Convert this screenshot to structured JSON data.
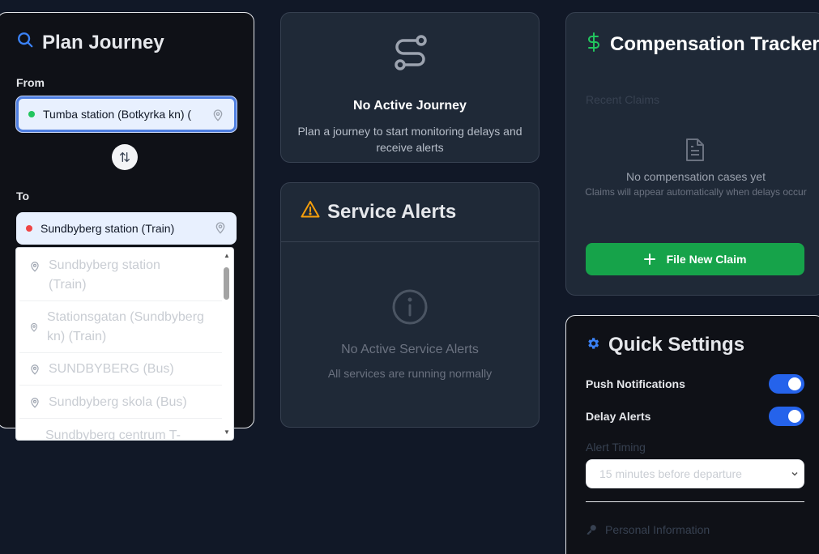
{
  "plan_journey": {
    "title": "Plan Journey",
    "from_label": "From",
    "from_value": "Tumba station (Botkyrka kn) (",
    "to_label": "To",
    "to_value": "Sundbyberg station (Train)",
    "suggestions": [
      "Sundbyberg station (Train)",
      "Stationsgatan (Sundbyberg kn) (Train)",
      "SUNDBYBERG (Bus)",
      "Sundbyberg skola (Bus)",
      "Sundbyberg centrum T-"
    ]
  },
  "no_journey": {
    "title": "No Active Journey",
    "text": "Plan a journey to start monitoring delays and receive alerts"
  },
  "service_alerts": {
    "title": "Service Alerts",
    "empty_title": "No Active Service Alerts",
    "empty_text": "All services are running normally"
  },
  "compensation": {
    "title": "Compensation Tracker",
    "recent_label": "Recent Claims",
    "empty_title": "No compensation cases yet",
    "empty_text": "Claims will appear automatically when delays occur",
    "file_button": "File New Claim"
  },
  "quick_settings": {
    "title": "Quick Settings",
    "push_label": "Push Notifications",
    "push_on": true,
    "delay_label": "Delay Alerts",
    "delay_on": true,
    "timing_label": "Alert Timing",
    "timing_value": "15 minutes before departure",
    "personal_label": "Personal Information"
  },
  "colors": {
    "accent_blue": "#2563eb",
    "green": "#16a34a",
    "from_dot": "#22c55e",
    "to_dot": "#ef4444",
    "warning": "#f59e0b"
  }
}
